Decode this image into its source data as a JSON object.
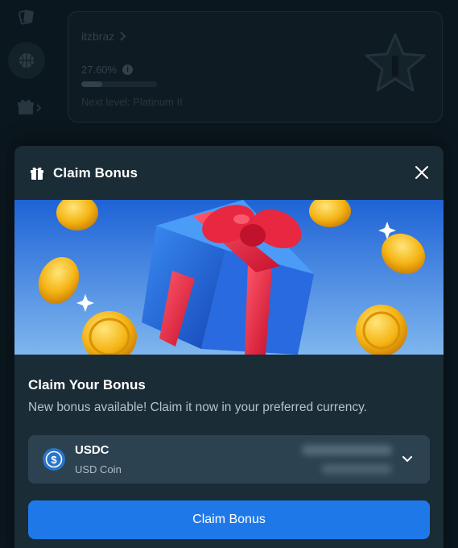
{
  "background": {
    "vip_card": {
      "username": "itzbraz",
      "progress_text": "27.60%",
      "progress": 0.276,
      "next_level": "Next level: Platinum II"
    }
  },
  "modal": {
    "title": "Claim Bonus",
    "heading": "Claim Your Bonus",
    "subtitle": "New bonus available! Claim it now in your preferred currency.",
    "currency": {
      "code": "USDC",
      "name": "USD Coin"
    },
    "claim_button_label": "Claim Bonus"
  },
  "colors": {
    "modal_bg": "#1a2c36",
    "select_bg": "#2c4250",
    "accent_blue": "#1f78e8",
    "usdc_blue": "#2775ca"
  },
  "icons": [
    "cards-icon",
    "basketball-icon",
    "gift-icon",
    "chevron-right-icon",
    "info-icon",
    "star-badge-icon",
    "close-icon",
    "usdc-coin-icon",
    "chevron-down-icon"
  ]
}
